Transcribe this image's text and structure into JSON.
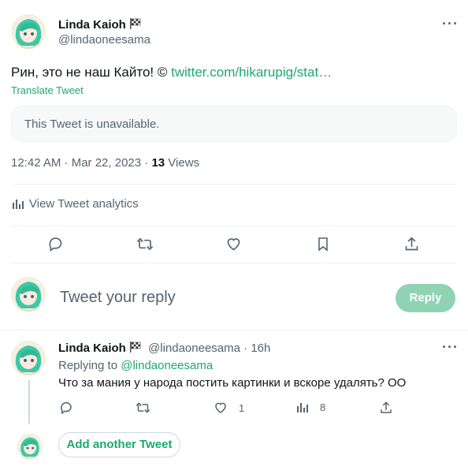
{
  "main_tweet": {
    "author_name": "Linda Kaioh",
    "author_handle": "@lindaoneesama",
    "text": "Рин, это не наш Кайто! © ",
    "link_text": "twitter.com/hikarupig/stat…",
    "translate_label": "Translate Tweet",
    "quoted_unavailable": "This Tweet is unavailable.",
    "time": "12:42 AM · Mar 22, 2023 · ",
    "views_count": "13",
    "views_label": " Views",
    "analytics_label": "View Tweet analytics"
  },
  "compose": {
    "placeholder": "Tweet your reply",
    "reply_button": "Reply"
  },
  "reply_tweet": {
    "author_name": "Linda Kaioh",
    "author_handle": "@lindaoneesama",
    "time": " · 16h",
    "replying_to_prefix": "Replying to ",
    "replying_to_handle": "@lindaoneesama",
    "text": "Что за мания у народа постить картинки и вскоре удалять? ОО",
    "like_count": "1",
    "views_count": "8"
  },
  "add_another": {
    "label": "Add another Tweet"
  },
  "colors": {
    "accent": "#1da86e",
    "reply_button_bg": "#8fd3b3",
    "secondary_text": "#536471"
  }
}
